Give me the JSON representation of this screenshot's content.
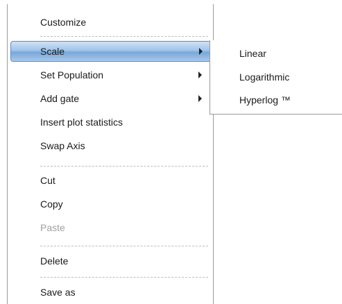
{
  "context_menu": {
    "items": [
      {
        "label": "Customize"
      },
      {
        "label": "Scale"
      },
      {
        "label": "Set Population"
      },
      {
        "label": "Add gate"
      },
      {
        "label": "Insert plot statistics"
      },
      {
        "label": "Swap Axis"
      },
      {
        "label": "Cut"
      },
      {
        "label": "Copy"
      },
      {
        "label": "Paste"
      },
      {
        "label": "Delete"
      },
      {
        "label": "Save as"
      }
    ],
    "highlighted_item": "Scale",
    "disabled_items": [
      "Paste"
    ],
    "highlight_color": "#9fc4ea"
  },
  "scale_submenu": {
    "items": [
      {
        "label": "Linear"
      },
      {
        "label": "Logarithmic"
      },
      {
        "label": "Hyperlog ™"
      }
    ]
  },
  "icons": {
    "submenu_arrow": "chevron-right-icon"
  }
}
